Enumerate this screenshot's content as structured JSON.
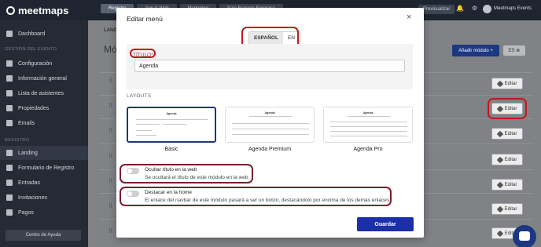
{
  "app": {
    "logo": "meetmaps",
    "top_tabs": [
      "Registro",
      "App & Web",
      "Marketing",
      "Sala Espacio Empresa"
    ],
    "preview_label": "Previsualizar",
    "user_name": "Meetmaps Events"
  },
  "sidebar": {
    "dashboard": "Dashboard",
    "section_event": "GESTIÓN DEL EVENTO",
    "event_items": [
      "Configuración",
      "Información general",
      "Lista de asistentes",
      "Propiedades",
      "Emails"
    ],
    "section_registro": "REGISTRO",
    "registro_items": [
      "Landing",
      "Formulario de Registro",
      "Entradas",
      "Invitaciones",
      "Pagos"
    ],
    "help_label": "Centro de Ayuda"
  },
  "main": {
    "tab": "LANDING",
    "title": "Módulos",
    "add_module_label": "Añadir módulo +",
    "language": "ES ⊕",
    "edit_label": "Editar"
  },
  "modal": {
    "title": "Editar menú",
    "close": "×",
    "languages": [
      "ESPAÑOL",
      "EN"
    ],
    "title_label": "TÍTULO*",
    "title_value": "Agenda",
    "layouts_label": "LAYOUTS",
    "layouts": [
      {
        "name": "Basic",
        "preview_title": "Agenda"
      },
      {
        "name": "Agenda Premium",
        "preview_title": "Agenda"
      },
      {
        "name": "Agenda Pro",
        "preview_title": "Agenda"
      }
    ],
    "toggles": [
      {
        "title": "Ocultar título en la web",
        "desc": "Se ocultará el título de este módulo en la web.",
        "on": false
      },
      {
        "title": "Destacar en la home",
        "desc": "El enlace del navbar de este módulo pasará a ser un botón, destacándolo por encima de los demás enlaces.",
        "on": false
      }
    ],
    "save_label": "Guardar"
  },
  "colors": {
    "primary": "#1b3880",
    "save": "#1b2fa8",
    "highlight": "#c4161c",
    "highlight_dark": "#7a1e2e"
  }
}
